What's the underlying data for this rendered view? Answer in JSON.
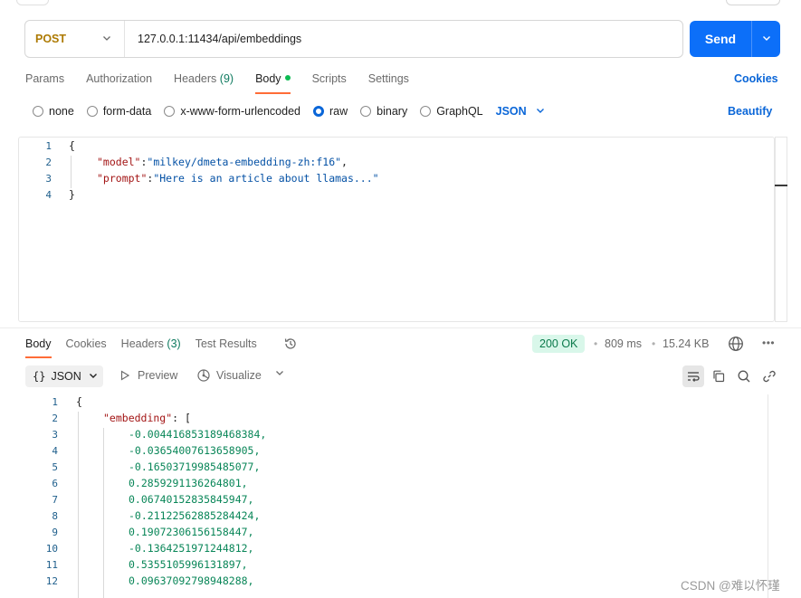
{
  "request": {
    "method": "POST",
    "url": "127.0.0.1:11434/api/embeddings",
    "send_label": "Send",
    "tabs": [
      {
        "label": "Params"
      },
      {
        "label": "Authorization"
      },
      {
        "label": "Headers",
        "count": "(9)"
      },
      {
        "label": "Body"
      },
      {
        "label": "Scripts"
      },
      {
        "label": "Settings"
      }
    ],
    "active_tab": "Body",
    "cookies_label": "Cookies",
    "body_types": [
      "none",
      "form-data",
      "x-www-form-urlencoded",
      "raw",
      "binary",
      "GraphQL"
    ],
    "selected_body_type": "raw",
    "format": "JSON",
    "beautify_label": "Beautify",
    "line_numbers": [
      "1",
      "2",
      "3",
      "4"
    ],
    "body_lines": {
      "open": "{",
      "model_key": "\"model\"",
      "model_value": "\"milkey/dmeta-embedding-zh:f16\"",
      "prompt_key": "\"prompt\"",
      "prompt_value": "\"Here is an article about llamas...\"",
      "close": "}"
    }
  },
  "response": {
    "tabs": [
      {
        "label": "Body"
      },
      {
        "label": "Cookies"
      },
      {
        "label": "Headers",
        "count": "(3)"
      },
      {
        "label": "Test Results"
      }
    ],
    "active_tab": "Body",
    "status": "200 OK",
    "time": "809 ms",
    "size": "15.24 KB",
    "format_label": "JSON",
    "preview_label": "Preview",
    "visualize_label": "Visualize",
    "line_numbers": [
      "1",
      "2",
      "3",
      "4",
      "5",
      "6",
      "7",
      "8",
      "9",
      "10",
      "11",
      "12"
    ],
    "open_brace": "{",
    "embedding_key": "\"embedding\"",
    "values": [
      "-0.004416853189468384,",
      "-0.03654007613658905,",
      "-0.16503719985485077,",
      "0.2859291136264801,",
      "0.06740152835845947,",
      "-0.21122562885284424,",
      "0.19072306156158447,",
      "-0.1364251971244812,",
      "0.5355105996131897,",
      "0.09637092798948288,"
    ]
  },
  "watermark": "CSDN @难以怀瑾",
  "colors": {
    "accent": "#0c6ff9",
    "method": "#ad7a03",
    "active_tab_underline": "#ff6c37",
    "status_bg": "#d9f7ea",
    "status_text": "#0b7a4b"
  },
  "icons": [
    "chevron-down-icon",
    "history-icon",
    "globe-icon",
    "more-icon",
    "braces-icon",
    "preview-play-icon",
    "visualize-icon",
    "wrap-lines-icon",
    "copy-icon",
    "search-icon",
    "link-icon"
  ]
}
